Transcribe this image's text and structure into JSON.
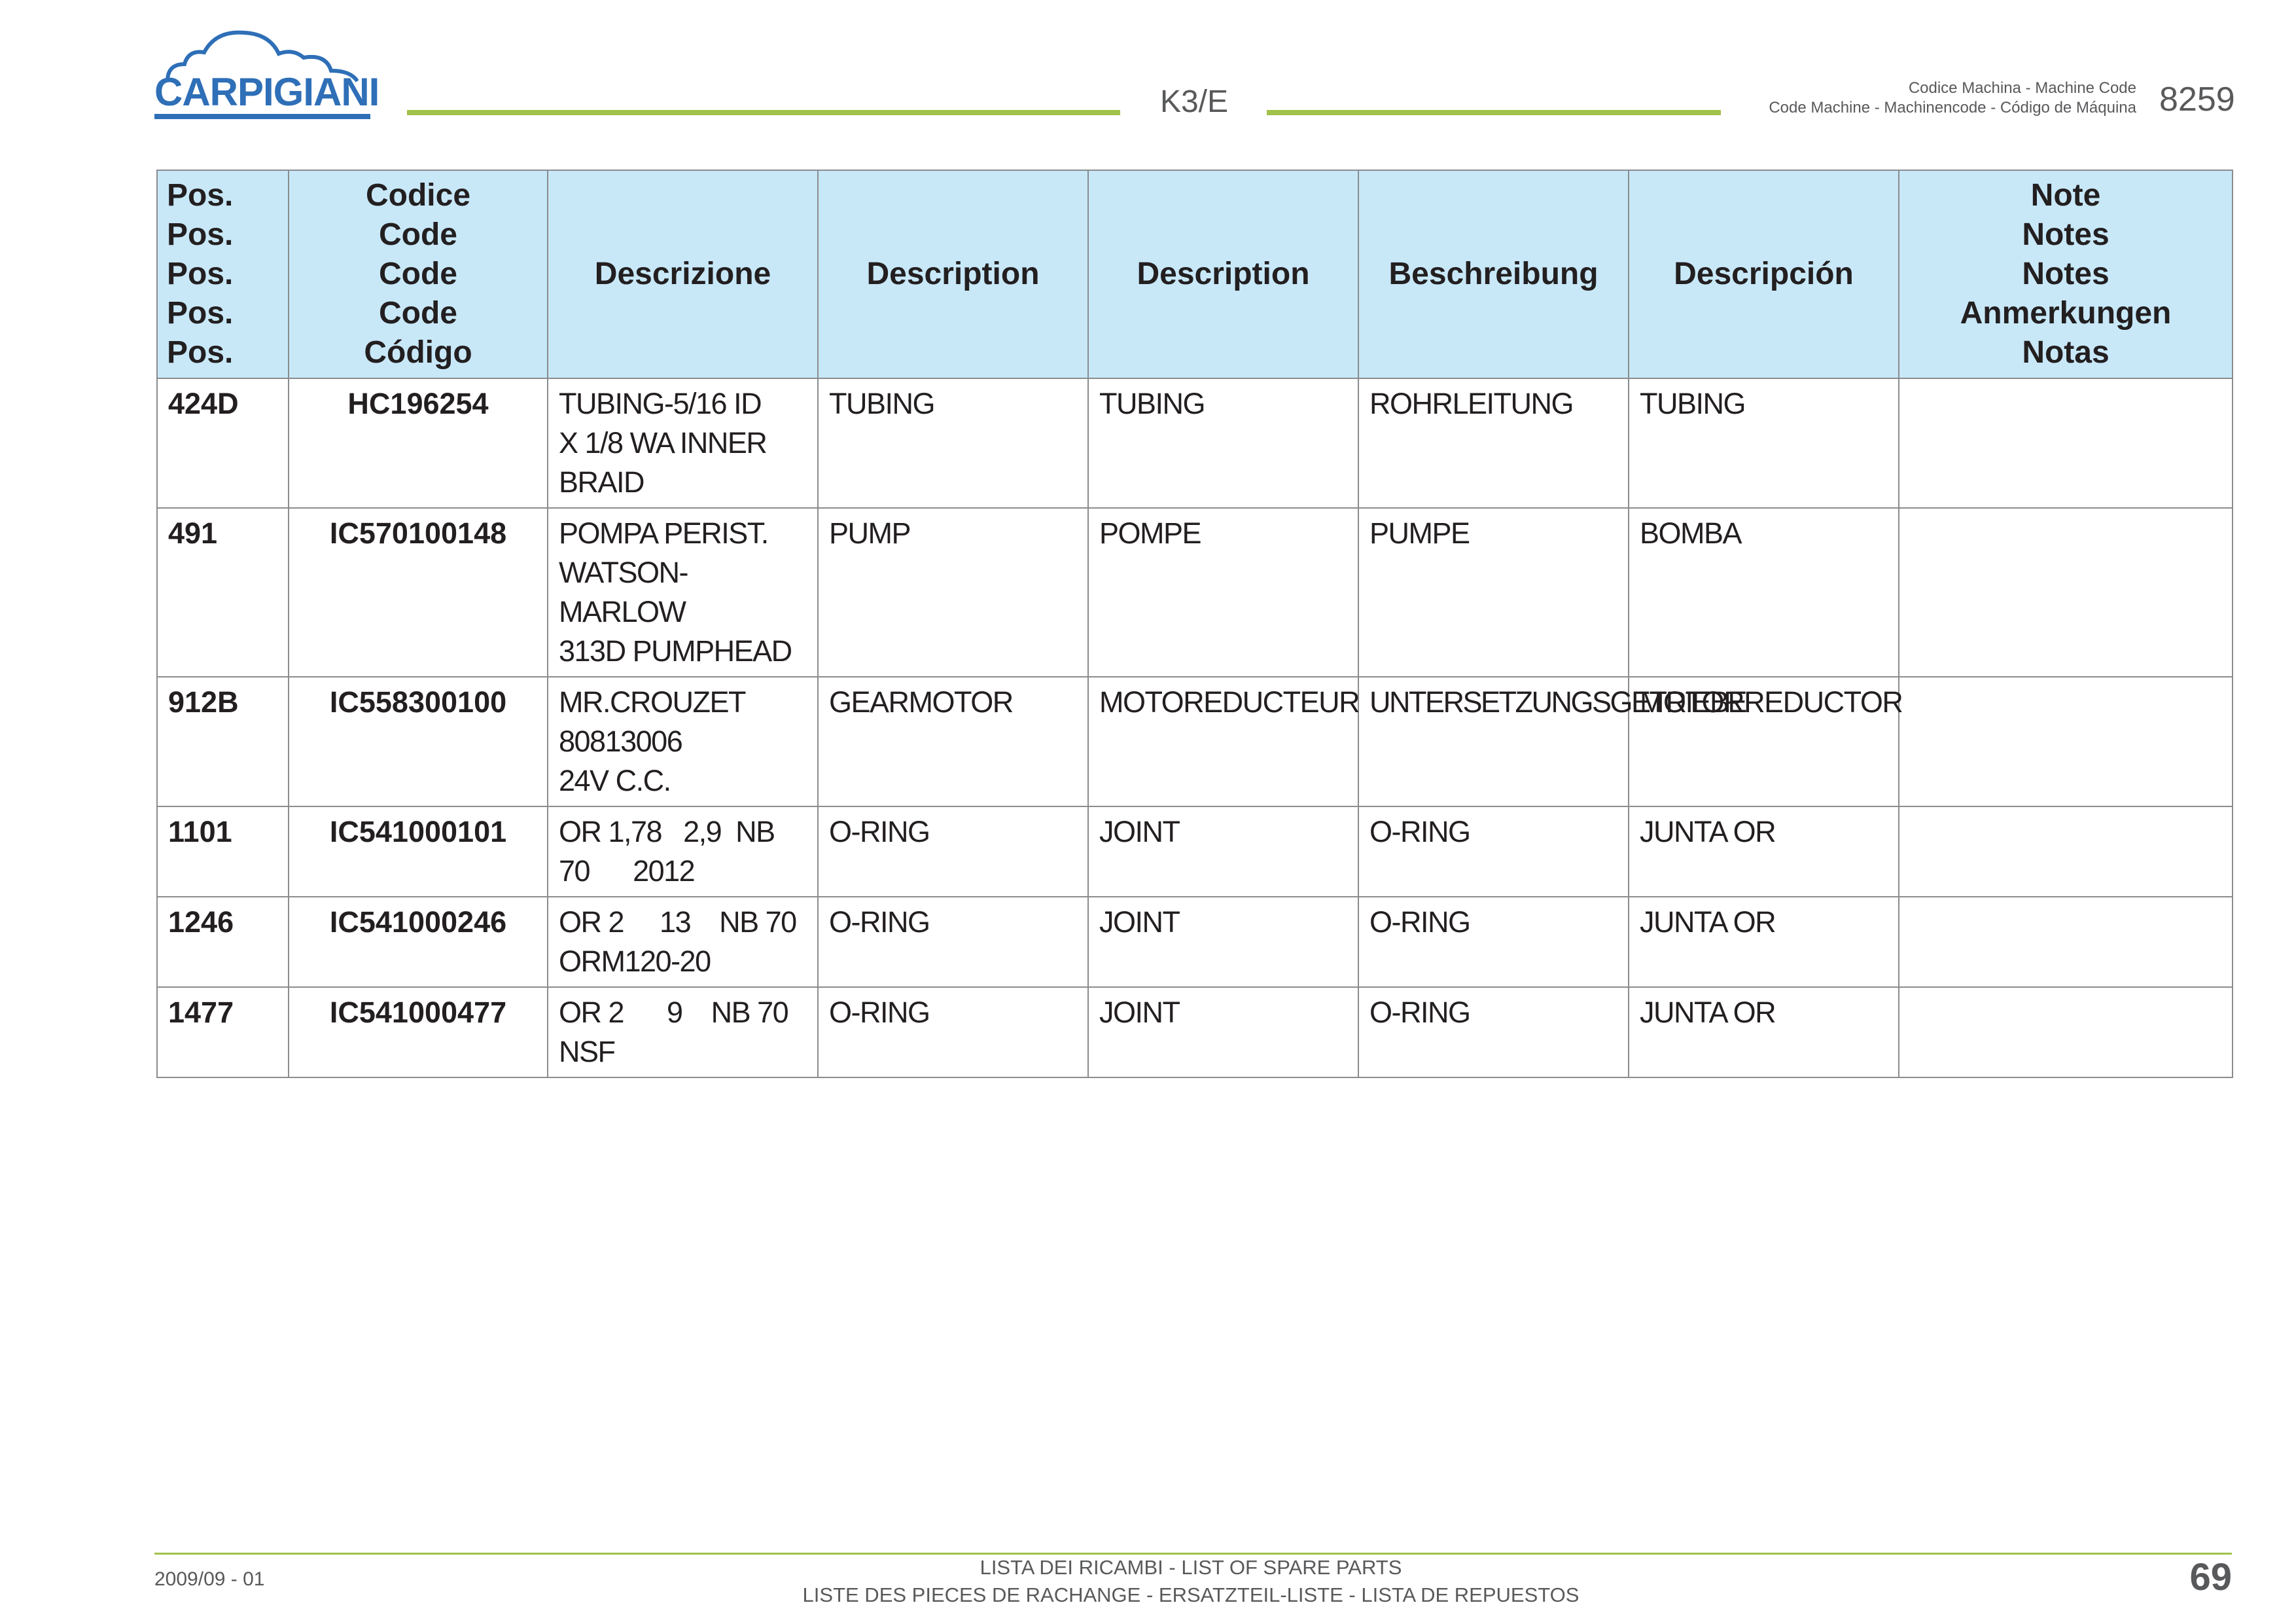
{
  "header": {
    "brand": "CARPIGIANI",
    "model": "K3/E",
    "machine_code_label_1": "Codice Machina - Machine Code",
    "machine_code_label_2": "Code Machine - Machinencode - Código de Máquina",
    "machine_code": "8259"
  },
  "table": {
    "headers": {
      "pos": "Pos.\nPos.\nPos.\nPos.\nPos.",
      "code": "Codice\nCode\nCode\nCode\nCódigo",
      "descrizione": "Descrizione",
      "description_en": "Description",
      "description_fr": "Description",
      "beschreibung": "Beschreibung",
      "descripcion": "Descripción",
      "note": "Note\nNotes\nNotes\nAnmerkungen\nNotas"
    },
    "rows": [
      {
        "pos": "424D",
        "code": "HC196254",
        "it": "TUBING-5/16 ID\nX 1/8 WA INNER\nBRAID",
        "en": "TUBING",
        "fr": "TUBING",
        "de": "ROHRLEITUNG",
        "es": "TUBING",
        "note": ""
      },
      {
        "pos": "491",
        "code": "IC570100148",
        "it": "POMPA PERIST.\nWATSON-MARLOW\n313D PUMPHEAD",
        "en": "PUMP",
        "fr": "POMPE",
        "de": "PUMPE",
        "es": "BOMBA",
        "note": ""
      },
      {
        "pos": "912B",
        "code": "IC558300100",
        "it": "MR.CROUZET\n80813006\n24V C.C.",
        "en": "GEARMOTOR",
        "fr": "MOTOREDUCTEUR",
        "de": "UNTERSETZUNGSGETRIEBE",
        "es": "MOTORREDUCTOR",
        "note": ""
      },
      {
        "pos": "1101",
        "code": "IC541000101",
        "it": "OR 1,78   2,9  NB\n70      2012",
        "en": "O-RING",
        "fr": "JOINT",
        "de": "O-RING",
        "es": "JUNTA OR",
        "note": ""
      },
      {
        "pos": "1246",
        "code": "IC541000246",
        "it": "OR 2     13    NB 70\nORM120-20",
        "en": "O-RING",
        "fr": "JOINT",
        "de": "O-RING",
        "es": "JUNTA OR",
        "note": ""
      },
      {
        "pos": "1477",
        "code": "IC541000477",
        "it": "OR 2      9    NB 70\nNSF",
        "en": "O-RING",
        "fr": "JOINT",
        "de": "O-RING",
        "es": "JUNTA OR",
        "note": ""
      }
    ]
  },
  "footer": {
    "date": "2009/09 - 01",
    "line1": "LISTA DEI RICAMBI - LIST OF SPARE PARTS",
    "line2": "LISTE DES PIECES DE RACHANGE - ERSATZTEIL-LISTE - LISTA DE REPUESTOS",
    "page": "69"
  },
  "colors": {
    "brand_blue": "#2e6fb7",
    "accent_green": "#a2c14a",
    "header_fill": "#c8e8f8"
  }
}
